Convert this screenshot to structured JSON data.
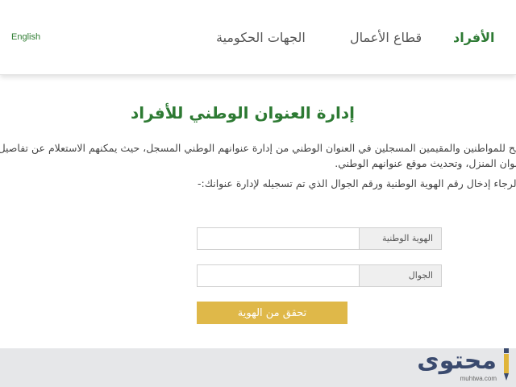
{
  "header": {
    "lang_link": "English",
    "nav": [
      {
        "label": "الجهات الحكومية",
        "active": false
      },
      {
        "label": "قطاع الأعمال",
        "active": false
      },
      {
        "label": "الأفراد",
        "active": true
      }
    ]
  },
  "main": {
    "title": "إدارة العنوان الوطني للأفراد",
    "intro_line1": "يتيح للمواطنين والمقيمين المسجلين في العنوان الوطني من إدارة عنوانهم الوطني المسجل، حيث يمكنهم الاستعلام عن تفاصيل",
    "intro_line2": "عنوان المنزل، وتحديث موقع عنوانهم الوطني.",
    "prompt": "الرجاء إدخال رقم الهوية الوطنية ورقم الجوال الذي تم تسجيله لإدارة عنوانك:-"
  },
  "form": {
    "id_label": "الهوية الوطنية",
    "id_value": "",
    "mobile_label": "الجوال",
    "mobile_value": "",
    "submit_label": "تحقق من الهوية"
  },
  "watermark": {
    "text": "محتوى",
    "url": "muhtwa.com"
  },
  "colors": {
    "primary_green": "#2d7a33",
    "button_gold": "#dfb849",
    "footer_gray": "#e6e7e9"
  }
}
